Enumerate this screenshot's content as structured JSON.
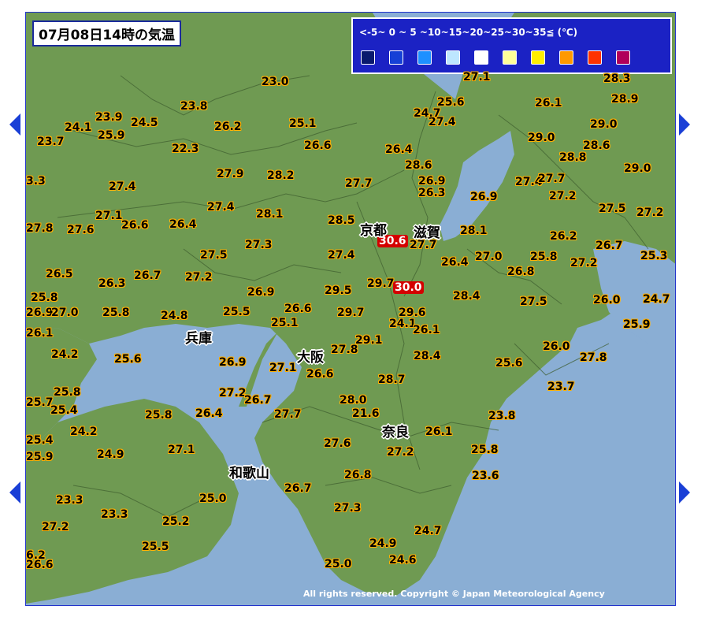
{
  "map": {
    "title": "07月08日14時の気温",
    "legend_labels": "<-5~ 0 ~ 5 ~10~15~20~25~30~35≦ (℃)",
    "legend_colors": [
      "#0a1a6e",
      "#1640d6",
      "#1e90ff",
      "#bde6ff",
      "#ffffff",
      "#ffff99",
      "#ffee00",
      "#ff9900",
      "#ff3300",
      "#b0005a"
    ],
    "copyright": "All rights reserved. Copyright © Japan Meteorological Agency",
    "prefectures": [
      "京都",
      "滋賀",
      "兵庫",
      "大阪",
      "奈良",
      "和歌山"
    ],
    "temps": [
      "23.0",
      "23.8",
      "24.1",
      "23.9",
      "24.5",
      "23.7",
      "25.9",
      "26.2",
      "25.1",
      "26.6",
      "22.3",
      "26.4",
      "27.4",
      "24.7",
      "25.6",
      "26.1",
      "27.1",
      "28.3",
      "28.9",
      "29.0",
      "28.6",
      "26.9",
      "27.4",
      "29.0",
      "28.8",
      "28.6",
      "29.0",
      "27.7",
      "27.4",
      "27.9",
      "28.2",
      "27.7",
      "26.3",
      "26.9",
      "27.2",
      "3.3",
      "27.5",
      "27.2",
      "27.4",
      "28.1",
      "27.1",
      "27.8",
      "27.6",
      "26.6",
      "26.4",
      "28.5",
      "30.6",
      "27.7",
      "28.1",
      "26.2",
      "26.7",
      "25.3",
      "27.3",
      "27.5",
      "27.4",
      "27.0",
      "25.8",
      "26.4",
      "27.2",
      "26.8",
      "26.5",
      "26.3",
      "26.7",
      "27.2",
      "26.9",
      "29.5",
      "29.7",
      "30.0",
      "28.4",
      "27.5",
      "26.0",
      "24.7",
      "25.8",
      "26.9",
      "27.0",
      "25.8",
      "24.8",
      "25.5",
      "26.6",
      "25.1",
      "29.7",
      "24.1",
      "29.6",
      "26.1",
      "25.9",
      "26.1",
      "29.1",
      "27.8",
      "26.0",
      "27.8",
      "24.2",
      "25.6",
      "26.9",
      "27.1",
      "26.6",
      "28.4",
      "25.6",
      "28.7",
      "23.7",
      "25.8",
      "25.7",
      "27.2",
      "26.7",
      "28.0",
      "25.4",
      "25.8",
      "26.4",
      "27.7",
      "21.6",
      "23.8",
      "26.1",
      "24.2",
      "25.4",
      "27.6",
      "27.2",
      "25.8",
      "24.9",
      "25.9",
      "27.1",
      "26.8",
      "23.6",
      "26.7",
      "23.3",
      "25.0",
      "27.3",
      "23.3",
      "25.2",
      "27.2",
      "24.7",
      "24.9",
      "25.5",
      "25.0",
      "24.6",
      "6.2",
      "26.6"
    ]
  }
}
